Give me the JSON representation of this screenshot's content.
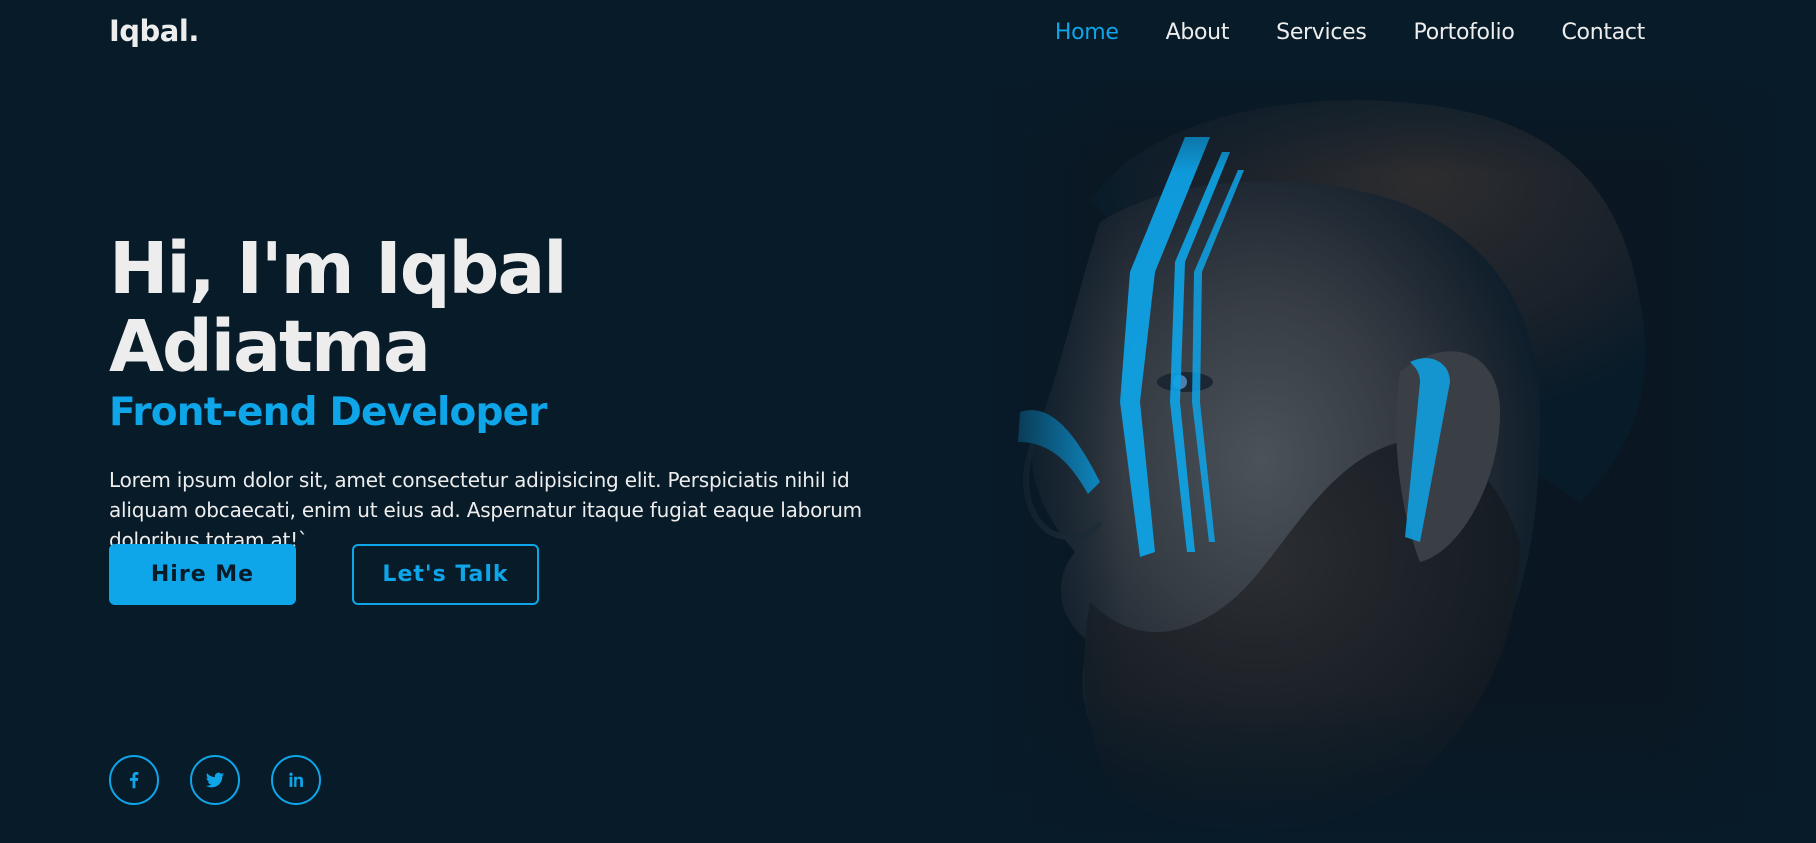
{
  "header": {
    "logo": "Iqbal.",
    "nav": [
      {
        "label": "Home",
        "active": true
      },
      {
        "label": "About",
        "active": false
      },
      {
        "label": "Services",
        "active": false
      },
      {
        "label": "Portofolio",
        "active": false
      },
      {
        "label": "Contact",
        "active": false
      }
    ]
  },
  "hero": {
    "title": "Hi, I'm Iqbal Adiatma",
    "subtitle": "Front-end Developer",
    "description": "Lorem ipsum dolor sit, amet consectetur adipisicing elit. Perspiciatis nihil id aliquam obcaecati, enim ut eius ad. Aspernatur itaque fugiat eaque laborum doloribus totam at!`",
    "primary_button": "Hire Me",
    "secondary_button": "Let's Talk"
  },
  "social": {
    "icons": [
      "facebook-icon",
      "twitter-icon",
      "linkedin-icon"
    ]
  },
  "colors": {
    "background": "#081b29",
    "accent": "#0ea5e9",
    "text": "#ededed"
  }
}
